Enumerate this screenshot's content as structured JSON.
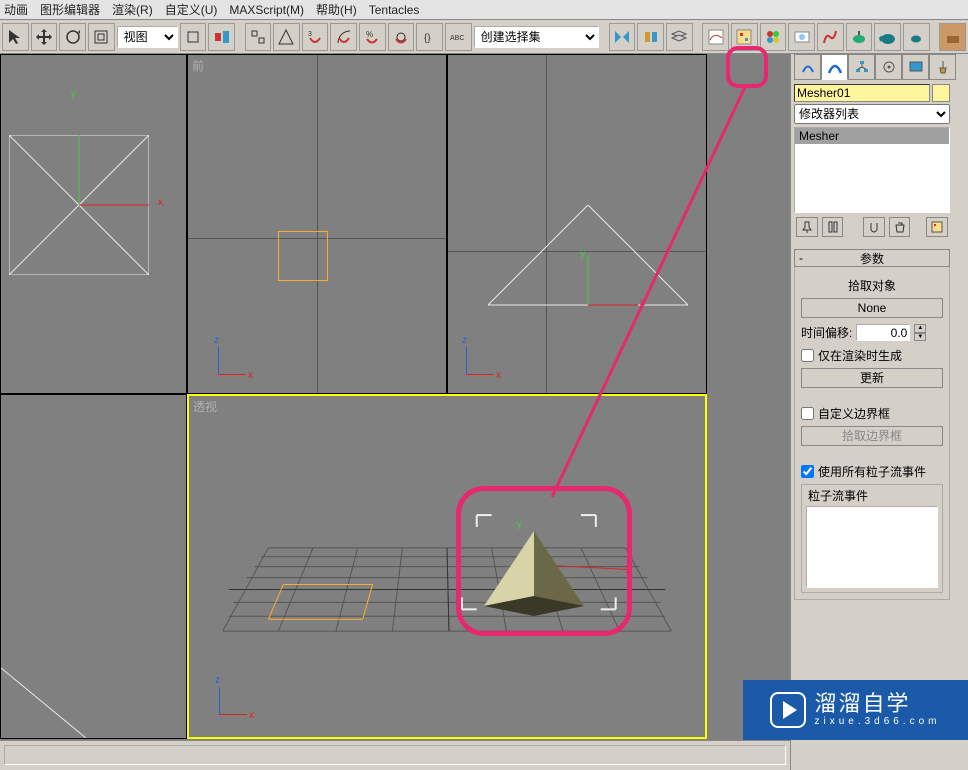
{
  "menu": {
    "items": [
      "动画",
      "图形编辑器",
      "渲染(R)",
      "自定义(U)",
      "MAXScript(M)",
      "帮助(H)",
      "Tentacles"
    ]
  },
  "toolbar": {
    "view_combo": "视图",
    "selset_placeholder": "创建选择集"
  },
  "viewports": {
    "top_mid_label": "前",
    "bot_right_label": "透视",
    "axis_z": "z",
    "axis_x": "x",
    "axis_y": "y"
  },
  "cmdpanel": {
    "object_name": "Mesher01",
    "modifier_combo": "修改器列表",
    "stack_item": "Mesher",
    "rollout_params": "参数",
    "pick_object_label": "拾取对象",
    "none_btn": "None",
    "time_offset_label": "时间偏移:",
    "time_offset_value": "0.0",
    "render_only": "仅在渲染时生成",
    "update_btn": "更新",
    "custom_bbox": "自定义边界框",
    "pick_bbox_btn": "拾取边界框",
    "use_all_pflow": "使用所有粒子流事件",
    "pflow_events_label": "粒子流事件"
  },
  "watermark": {
    "title": "溜溜自学",
    "sub": "zixue.3d66.com"
  }
}
